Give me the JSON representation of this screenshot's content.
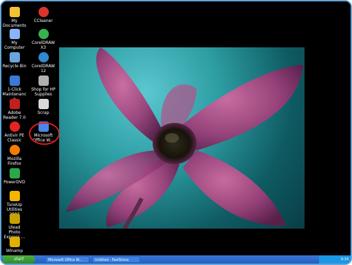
{
  "desktop": {
    "icons": [
      {
        "label": "My Documents",
        "icon": "folder-icon",
        "color": "#f1c232"
      },
      {
        "label": "CCleaner",
        "icon": "ccleaner-icon",
        "color": "#d9352c"
      },
      {
        "label": "My Computer",
        "icon": "computer-icon",
        "color": "#8ab4f8"
      },
      {
        "label": "CorelDRAW X3",
        "icon": "coreldraw-x3-icon",
        "color": "#37b24d"
      },
      {
        "label": "Recycle Bin",
        "icon": "recycle-bin-icon",
        "color": "#6aa4dd"
      },
      {
        "label": "CorelDRAW 12",
        "icon": "coreldraw-12-icon",
        "color": "#2f8ad0"
      },
      {
        "label": "1-Click Maintenance",
        "icon": "maintenance-icon",
        "color": "#3c78d8"
      },
      {
        "label": "Shop for HP Supplies",
        "icon": "hp-shop-icon",
        "color": "#b0b0b0"
      },
      {
        "label": "Adobe Reader 7.0",
        "icon": "adobe-reader-icon",
        "color": "#c21f1f"
      },
      {
        "label": "Scrap",
        "icon": "scrap-icon",
        "color": "#d9d9d9"
      },
      {
        "label": "Antivir PE Classic",
        "icon": "antivir-icon",
        "color": "#e52323"
      },
      {
        "label": "Microsoft Office W...",
        "icon": "word-doc-icon",
        "color": "#4a86e8"
      },
      {
        "label": "Mozilla Firefox",
        "icon": "firefox-icon",
        "color": "#f57c00"
      },
      {
        "label": "PowerDVD",
        "icon": "powerdvd-icon",
        "color": "#2aa84a"
      },
      {
        "label": "TuneUp Utilities 2007",
        "icon": "tuneup-icon",
        "color": "#f4b400"
      },
      {
        "label": "Ulead Photo Express ...",
        "icon": "ulead-icon",
        "color": "#c8a000"
      },
      {
        "label": "Winamp",
        "icon": "winamp-icon",
        "color": "#e0b000"
      }
    ]
  },
  "taskbar": {
    "start_label": "start",
    "tasks": [
      "Microsoft Office W...",
      "Untitled - FastStone"
    ],
    "clock": "9:34"
  }
}
